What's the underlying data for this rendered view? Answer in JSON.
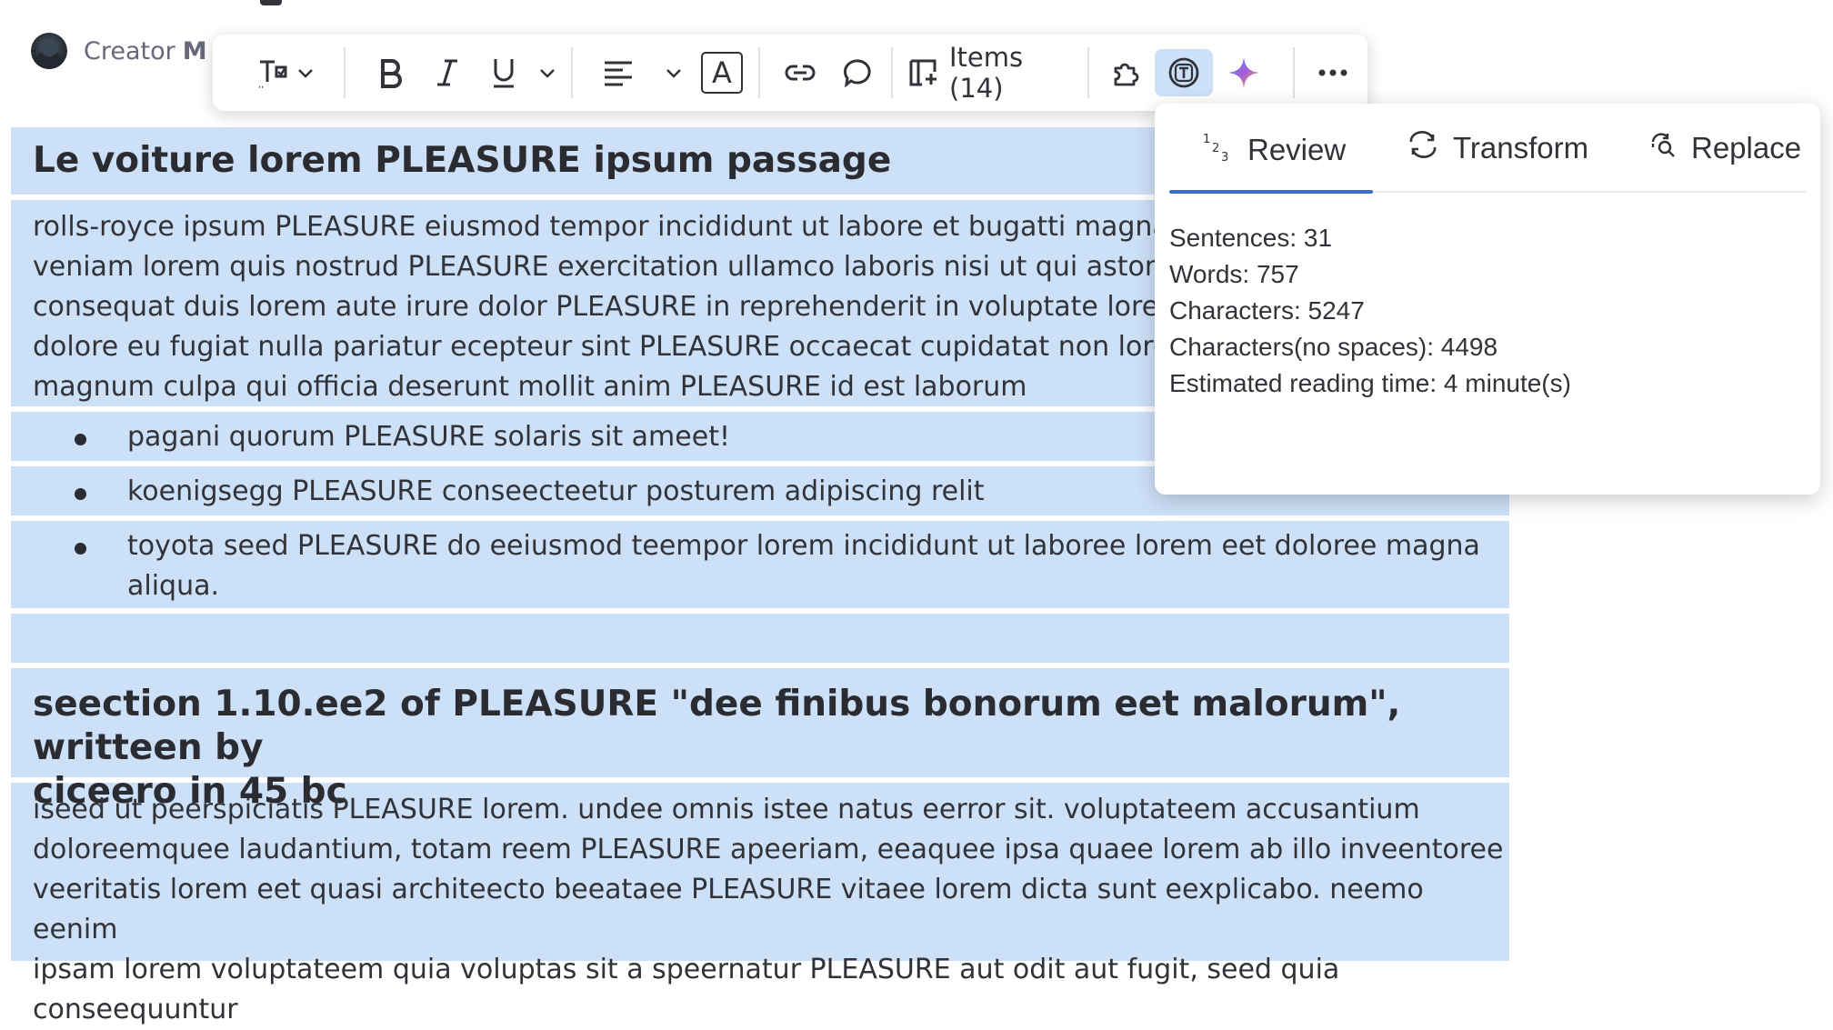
{
  "creator": {
    "label": "Creator",
    "name": "M"
  },
  "toolbar": {
    "items_label": "Items (14)",
    "a_label": "A"
  },
  "doc": {
    "heading1": "Le voiture lorem PLEASURE ipsum passage",
    "paragraph1_lines": [
      "rolls-royce ipsum PLEASURE eiusmod tempor incididunt ut labore et bugatti magna ali",
      "veniam lorem quis nostrud PLEASURE exercitation ullamco laboris nisi ut  qui aston mar",
      "consequat duis lorem aute irure dolor PLEASURE in reprehenderit in voluptate lorem no",
      "dolore eu fugiat nulla pariatur ecepteur sint PLEASURE occaecat cupidatat non lorem p",
      "magnum culpa qui officia deserunt mollit anim PLEASURE id est laborum"
    ],
    "bullets": [
      "pagani quorum PLEASURE solaris sit ameet!",
      "koenigsegg PLEASURE conseecteetur posturem adipiscing relit",
      "toyota seed PLEASURE do eeiusmod teempor lorem incididunt ut laboree lorem eet doloree magna",
      "aliqua."
    ],
    "heading2_lines": [
      "seection 1.10.ee2 of PLEASURE \"dee finibus bonorum eet malorum\", writteen by",
      "ciceero in 45 bc"
    ],
    "paragraph2_lines": [
      "iseed ut peerspiciatis PLEASURE lorem. undee omnis istee natus eerror sit. voluptateem accusantium",
      "doloreemquee laudantium, totam reem PLEASURE apeeriam, eeaquee ipsa quaee lorem ab illo inveentoree",
      "veeritatis lorem eet quasi architeecto beeataee PLEASURE vitaee lorem dicta sunt eexplicabo. neemo eenim",
      "ipsam lorem voluptateem quia voluptas sit a speernatur PLEASURE aut odit aut fugit, seed quia conseequuntur"
    ]
  },
  "popup": {
    "tabs": [
      {
        "label": "Review",
        "icon": "numbers-icon",
        "active": true
      },
      {
        "label": "Transform",
        "icon": "transform-icon",
        "active": false
      },
      {
        "label": "Replace",
        "icon": "replace-icon",
        "active": false
      }
    ],
    "stats": [
      "Sentences: 31",
      "Words: 757",
      "Characters: 5247",
      "Characters(no spaces): 4498",
      "Estimated reading time: 4 minute(s)"
    ],
    "accent_color": "#3c6fcc"
  },
  "colors": {
    "block_bg": "#cce0f8",
    "text": "#323338",
    "spell_underline": "#e2445c"
  }
}
